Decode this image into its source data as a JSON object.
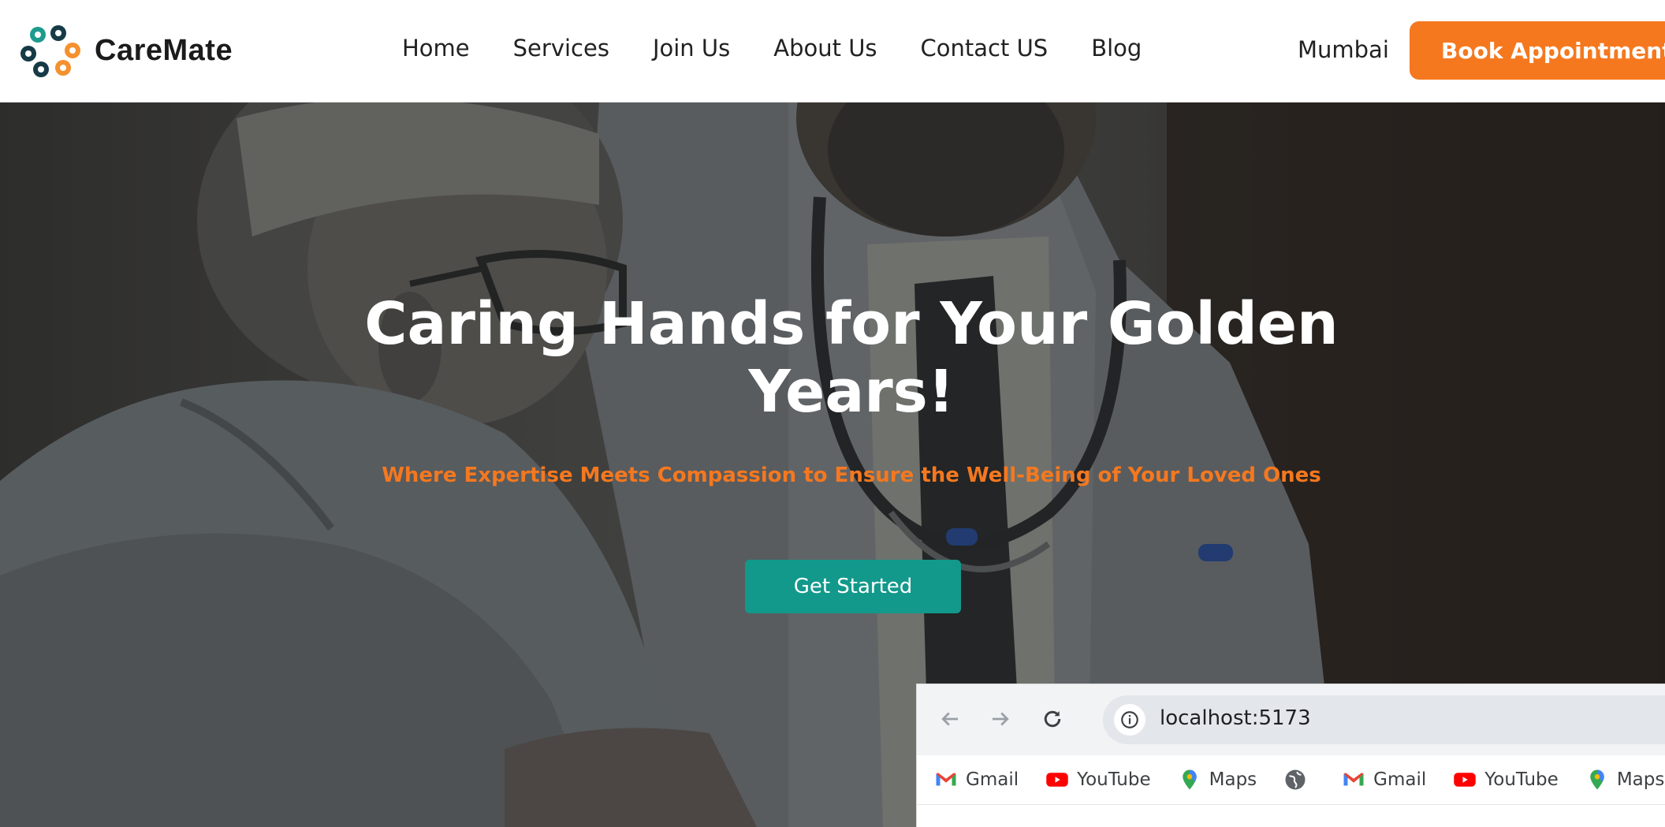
{
  "brand": {
    "name": "CareMate",
    "colors": {
      "accent": "#f5781f",
      "teal": "#12998b",
      "logo_dark": "#163b46",
      "logo_teal": "#1c9b8e"
    }
  },
  "nav": {
    "items": [
      {
        "label": "Home"
      },
      {
        "label": "Services"
      },
      {
        "label": "Join Us"
      },
      {
        "label": "About Us"
      },
      {
        "label": "Contact US"
      },
      {
        "label": "Blog"
      }
    ],
    "city": "Mumbai",
    "book_label": "Book Appointment"
  },
  "hero": {
    "title_line1": "Caring Hands for Your Golden",
    "title_line2": "Years!",
    "subtitle": "Where Expertise Meets Compassion to Ensure the Well-Being of Your Loved Ones",
    "cta_label": "Get Started"
  },
  "browser": {
    "url": "localhost:5173",
    "icons": {
      "back": "back-arrow-icon",
      "forward": "forward-arrow-icon",
      "reload": "reload-icon",
      "info": "info-icon"
    },
    "bookmarks": [
      {
        "label": "Gmail",
        "icon": "gmail-icon"
      },
      {
        "label": "YouTube",
        "icon": "youtube-icon"
      },
      {
        "label": "Maps",
        "icon": "maps-icon"
      },
      {
        "label": "",
        "icon": "globe-icon"
      },
      {
        "label": "Gmail",
        "icon": "gmail-icon"
      },
      {
        "label": "YouTube",
        "icon": "youtube-icon"
      },
      {
        "label": "Maps",
        "icon": "maps-icon"
      }
    ]
  }
}
